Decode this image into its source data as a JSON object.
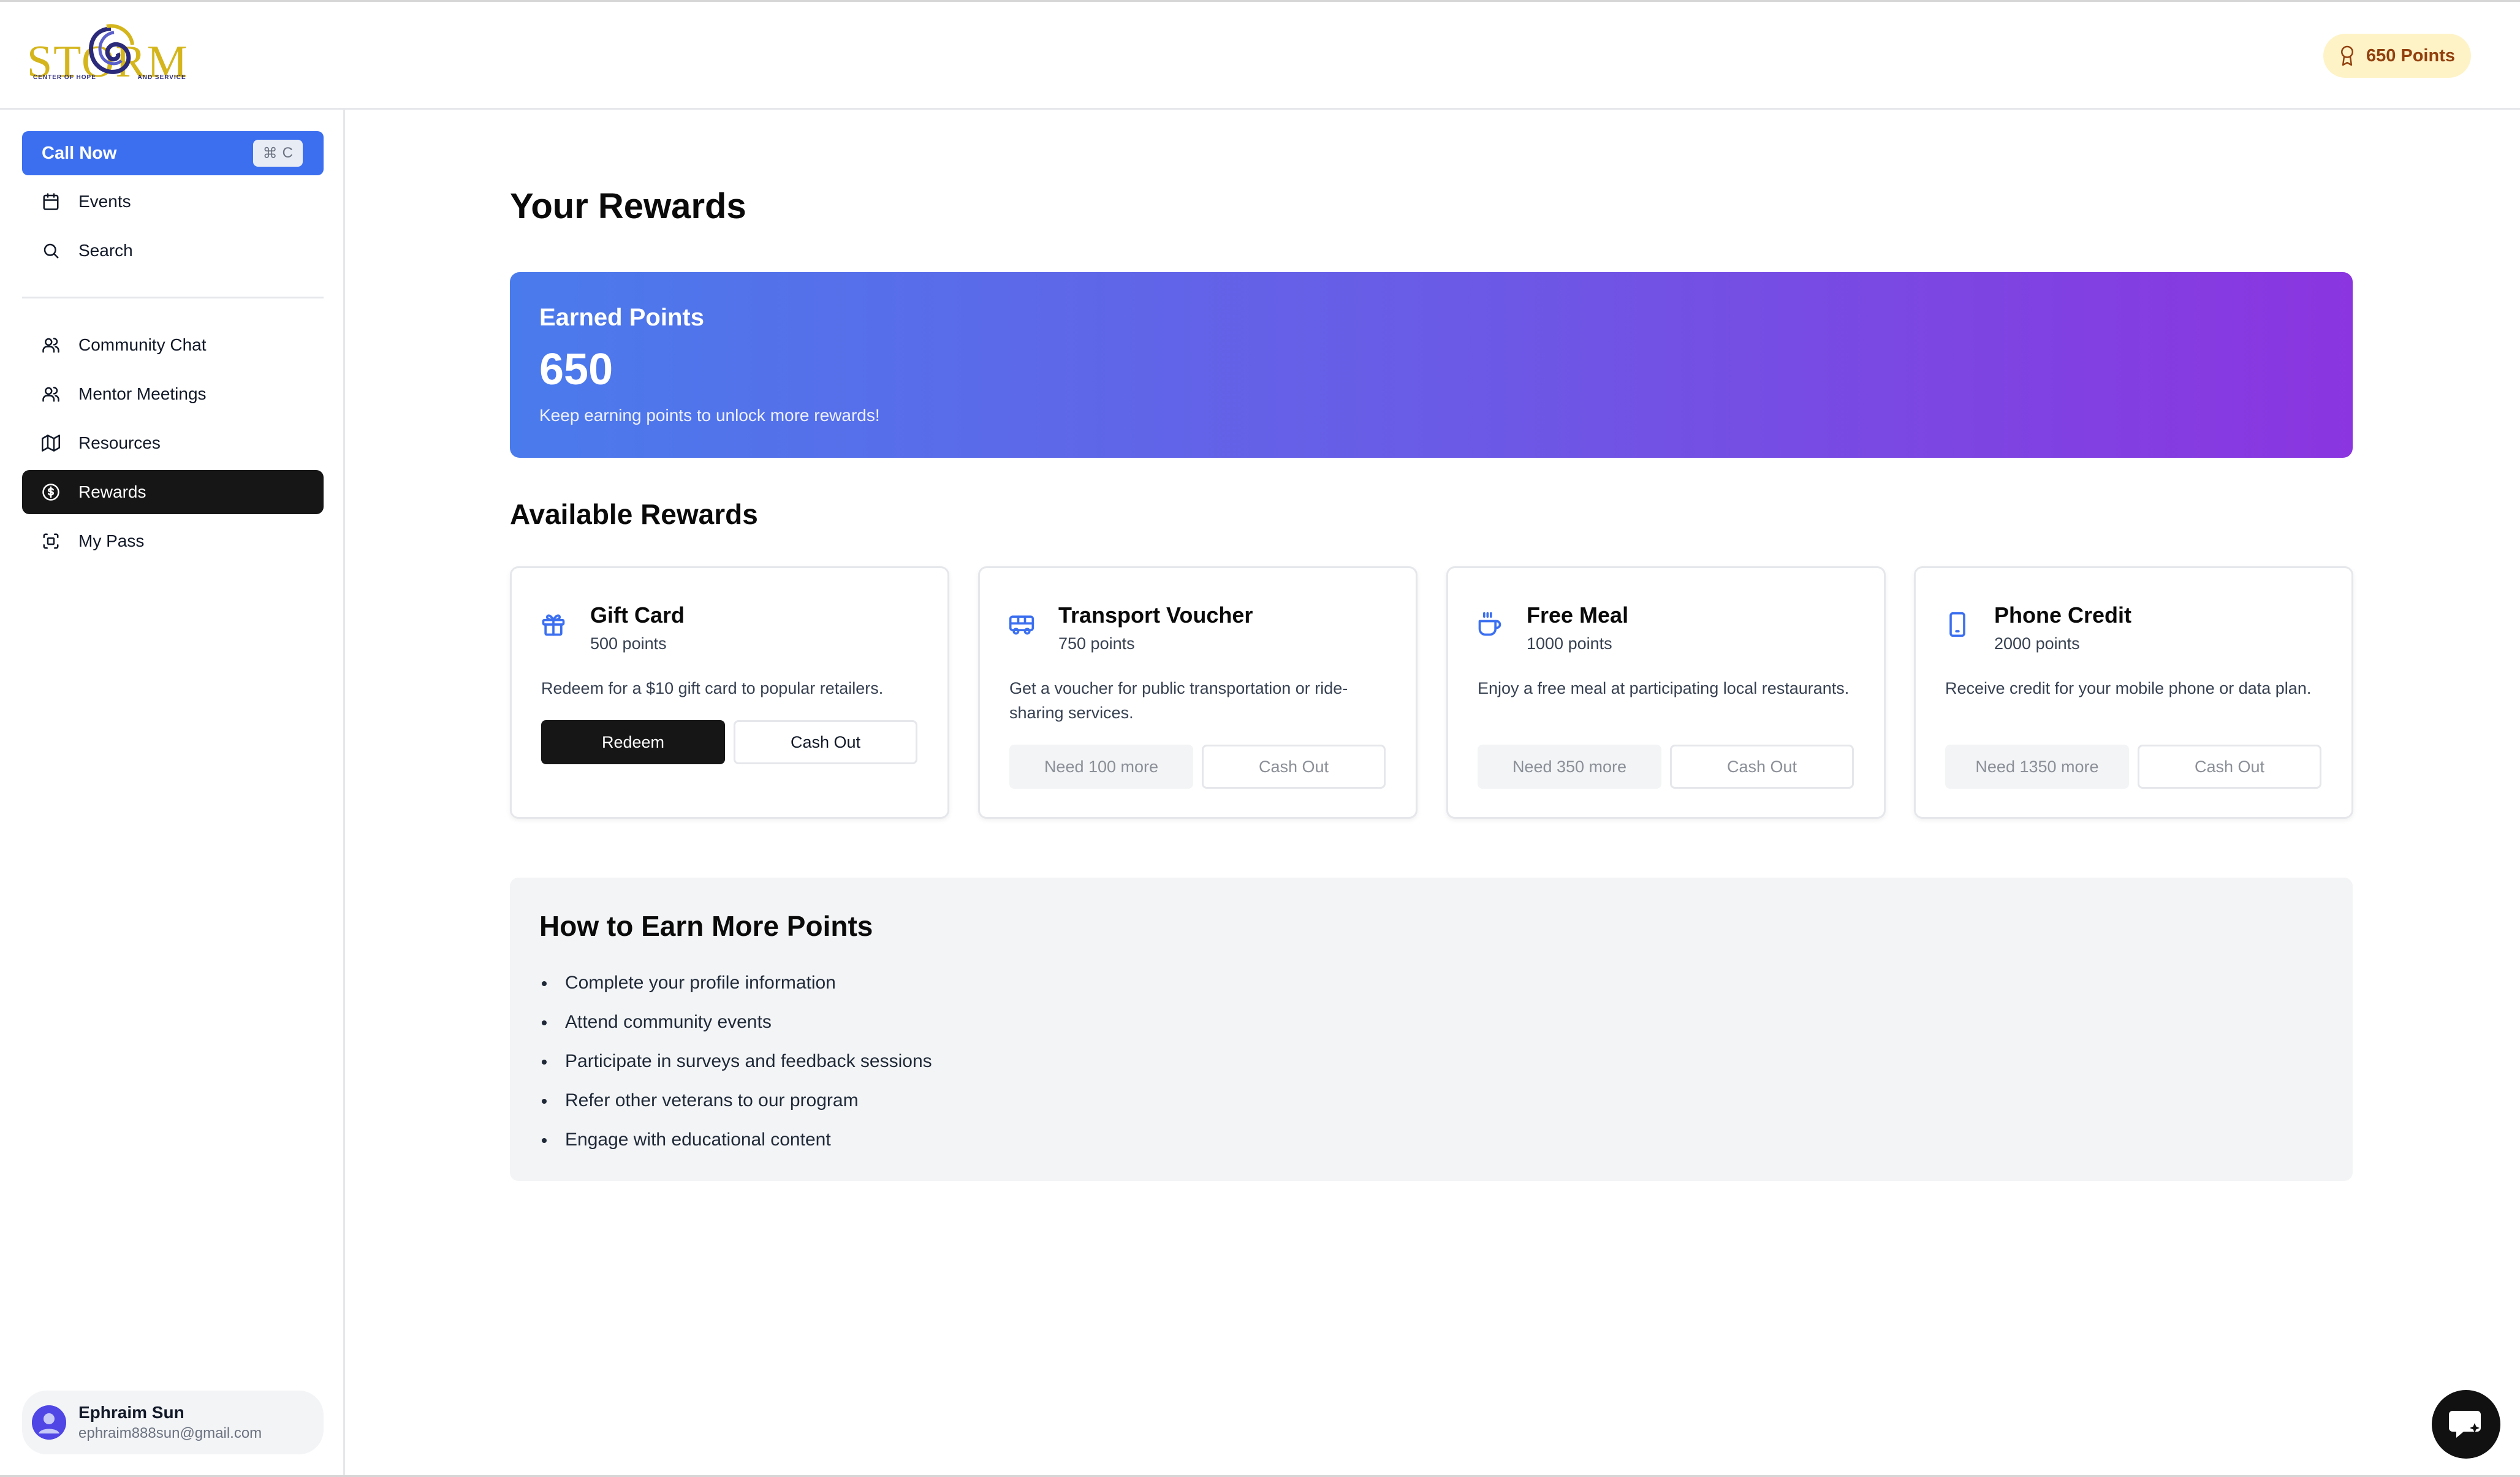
{
  "header": {
    "logo_text": "STORM",
    "logo_tag_left": "CENTER OF HOPE",
    "logo_tag_right": "AND SERVICE",
    "points_label": "650 Points",
    "points_icon": "award-icon"
  },
  "sidebar": {
    "call_now": {
      "label": "Call Now",
      "shortcut_key": "C",
      "shortcut_symbol": "⌘"
    },
    "top_items": [
      {
        "label": "Events",
        "icon": "calendar-icon"
      },
      {
        "label": "Search",
        "icon": "search-icon"
      }
    ],
    "items": [
      {
        "label": "Community Chat",
        "icon": "users-icon"
      },
      {
        "label": "Mentor Meetings",
        "icon": "users-icon"
      },
      {
        "label": "Resources",
        "icon": "map-icon"
      },
      {
        "label": "Rewards",
        "icon": "dollar-circle-icon",
        "active": true
      },
      {
        "label": "My Pass",
        "icon": "scan-icon"
      }
    ],
    "user": {
      "name": "Ephraim Sun",
      "email": "ephraim888sun@gmail.com"
    }
  },
  "main": {
    "title": "Your Rewards",
    "earned": {
      "title": "Earned Points",
      "value": "650",
      "subtitle": "Keep earning points to unlock more rewards!"
    },
    "available_title": "Available Rewards",
    "rewards": [
      {
        "title": "Gift Card",
        "points": "500 points",
        "description": "Redeem for a $10 gift card to popular retailers.",
        "primary": "Redeem",
        "secondary": "Cash Out",
        "icon": "gift-icon"
      },
      {
        "title": "Transport Voucher",
        "points": "750 points",
        "description": "Get a voucher for public transportation or ride-sharing services.",
        "primary": "Need 100 more",
        "secondary": "Cash Out",
        "icon": "bus-icon"
      },
      {
        "title": "Free Meal",
        "points": "1000 points",
        "description": "Enjoy a free meal at participating local restaurants.",
        "primary": "Need 350 more",
        "secondary": "Cash Out",
        "icon": "coffee-icon"
      },
      {
        "title": "Phone Credit",
        "points": "2000 points",
        "description": "Receive credit for your mobile phone or data plan.",
        "primary": "Need 1350 more",
        "secondary": "Cash Out",
        "icon": "smartphone-icon"
      }
    ],
    "howto": {
      "title": "How to Earn More Points",
      "items": [
        "Complete your profile information",
        "Attend community events",
        "Participate in surveys and feedback sessions",
        "Refer other veterans to our program",
        "Engage with educational content"
      ]
    }
  },
  "colors": {
    "accent_blue": "#3b6ff0",
    "gradient_start": "#4a7bec",
    "gradient_end": "#8b35e0",
    "active_nav": "#161616",
    "points_pill_bg": "#fef3c7",
    "points_pill_text": "#92400e",
    "logo_gold": "#d4b51c"
  }
}
